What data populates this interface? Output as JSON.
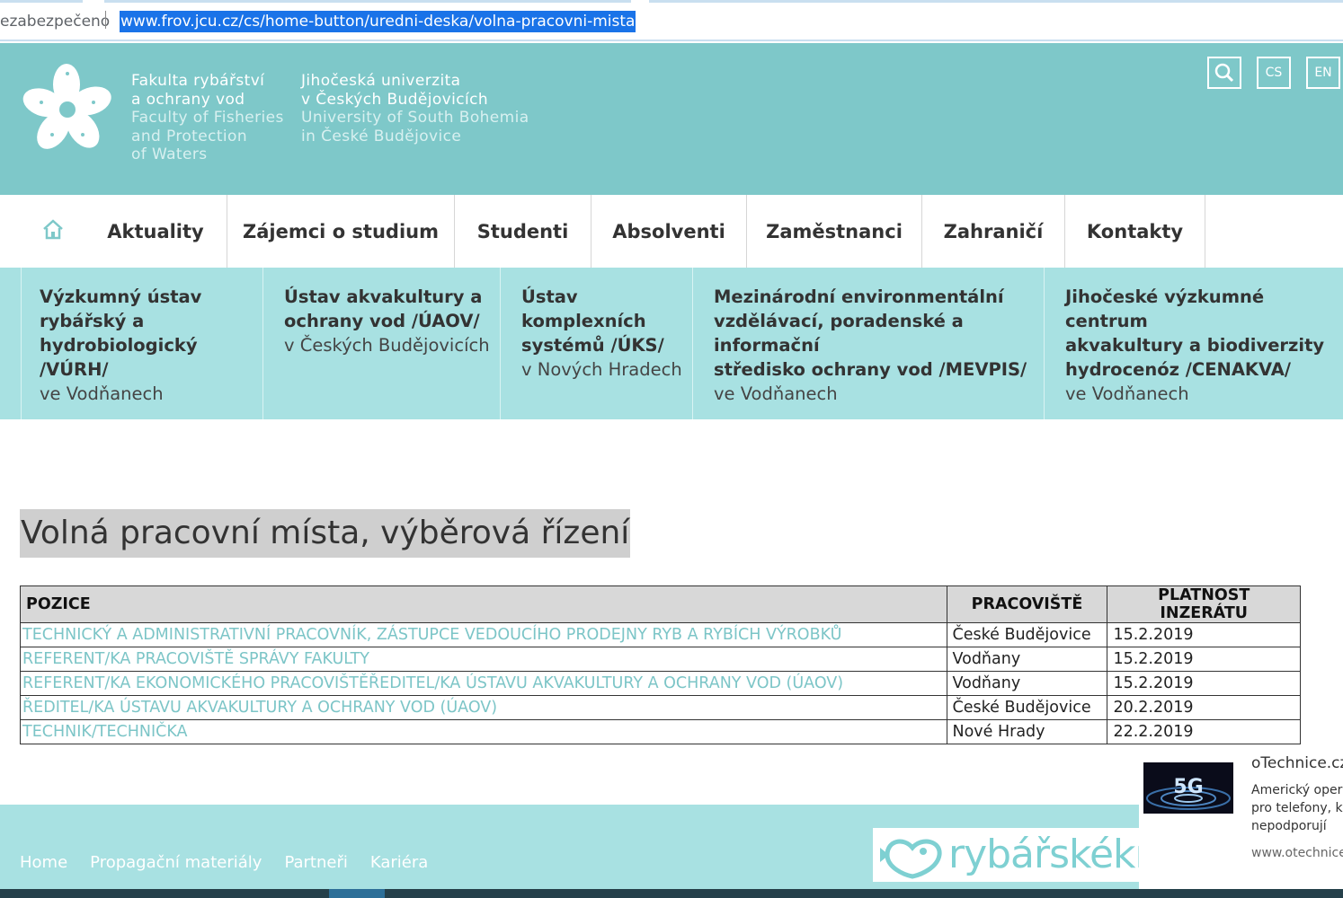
{
  "browser": {
    "security_text": "ezabezpečeno",
    "url": "www.frov.jcu.cz/cs/home-button/uredni-deska/volna-pracovni-mista"
  },
  "header": {
    "faculty_lines": [
      "Fakulta rybářství",
      "a ochrany vod",
      "Faculty of Fisheries",
      "and Protection",
      "of Waters"
    ],
    "university_lines": [
      "Jihočeská univerzita",
      "v Českých Budějovicích",
      "University of South Bohemia",
      "in České Budějovice"
    ],
    "lang_cs": "CS",
    "lang_en": "EN"
  },
  "nav": {
    "items": [
      "Aktuality",
      "Zájemci o studium",
      "Studenti",
      "Absolventi",
      "Zaměstnanci",
      "Zahraničí",
      "Kontakty"
    ]
  },
  "institutes": [
    {
      "title": "Výzkumný ústav\nrybářský a\nhydrobiologický /VÚRH/",
      "sub": "ve Vodňanech"
    },
    {
      "title": "Ústav akvakultury a\nochrany vod /ÚAOV/",
      "sub": "v Českých Budějovicích"
    },
    {
      "title": "Ústav\nkomplexních\nsystémů /ÚKS/",
      "sub": "v Nových Hradech"
    },
    {
      "title": "Mezinárodní environmentální\nvzdělávací, poradenské a informační\nstředisko ochrany vod /MEVPIS/",
      "sub": "ve Vodňanech"
    },
    {
      "title": "Jihočeské výzkumné centrum\nakvakultury a biodiverzity\nhydrocenóz /CENAKVA/",
      "sub": "ve Vodňanech"
    }
  ],
  "page": {
    "title": "Volná pracovní místa, výběrová řízení"
  },
  "jobs": {
    "headers": [
      "POZICE",
      "PRACOVIŠTĚ",
      "PLATNOST INZERÁTU"
    ],
    "rows": [
      {
        "position": "TECHNICKÝ A ADMINISTRATIVNÍ PRACOVNÍK, ZÁSTUPCE VEDOUCÍHO PRODEJNY RYB A RYBÍCH VÝROBKŮ",
        "place": "České Budějovice",
        "valid": "15.2.2019"
      },
      {
        "position": "REFERENT/KA PRACOVIŠTĚ SPRÁVY FAKULTY",
        "place": "Vodňany",
        "valid": "15.2.2019"
      },
      {
        "position": "REFERENT/KA EKONOMICKÉHO PRACOVIŠTĚŘEDITEL/KA ÚSTAVU AKVAKULTURY A OCHRANY VOD (ÚAOV)",
        "place": "Vodňany",
        "valid": "15.2.2019"
      },
      {
        "position": "ŘEDITEL/KA ÚSTAVU AKVAKULTURY A OCHRANY VOD (ÚAOV)",
        "place": "České Budějovice",
        "valid": "20.2.2019"
      },
      {
        "position": "TECHNIK/TECHNIČKA",
        "place": "Nové Hrady",
        "valid": "22.2.2019"
      }
    ]
  },
  "footer": {
    "links": [
      "Home",
      "Propagační materiály",
      "Partneři",
      "Kariéra"
    ],
    "banner_text": "rybářskéknil"
  },
  "ad": {
    "source": "oTechnice.cz",
    "thumb_text": "5G",
    "body_lines": [
      "Americký operá",
      "pro telefony, kte",
      "nepodporují"
    ],
    "url": "www.otechnice."
  }
}
